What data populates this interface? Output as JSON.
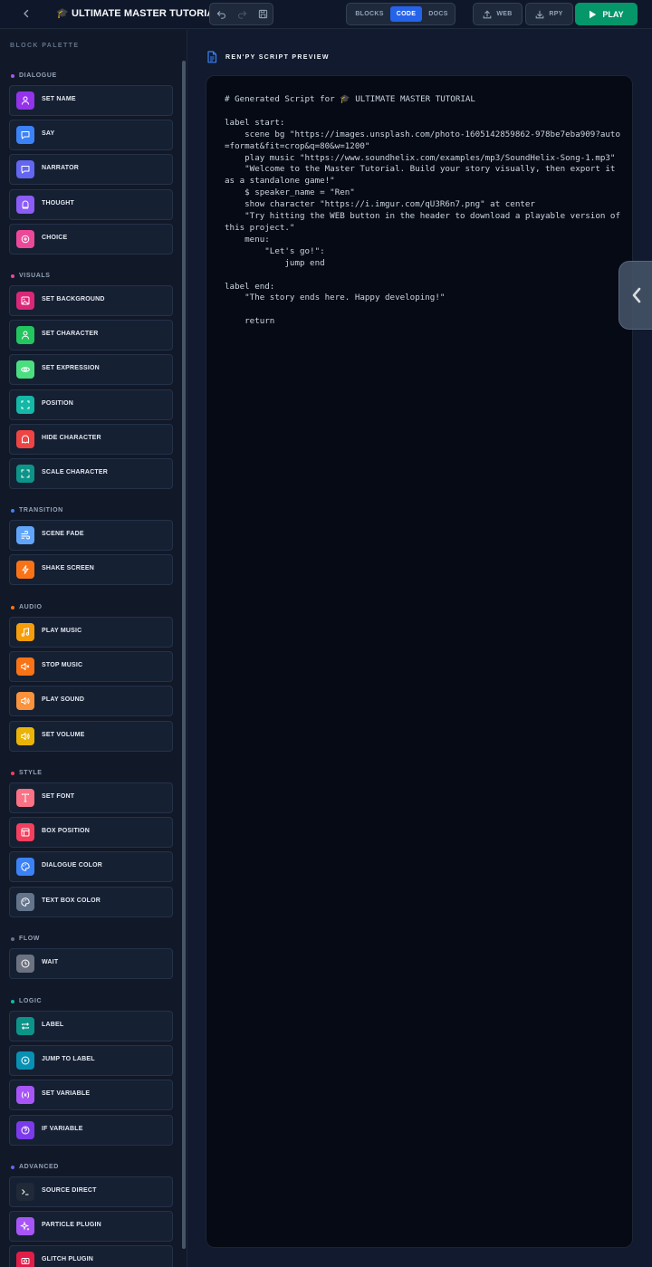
{
  "header": {
    "title": "🎓 ULTIMATE MASTER TUTORIAL",
    "view_tabs": {
      "blocks": "BLOCKS",
      "code": "CODE",
      "docs": "DOCS"
    },
    "export_web": "WEB",
    "export_rpy": "RPY",
    "play": "PLAY"
  },
  "sidebar": {
    "title": "BLOCK PALETTE",
    "categories": [
      {
        "label": "DIALOGUE",
        "color": "#a855f7",
        "items": [
          {
            "label": "SET NAME",
            "icon": "person-icon",
            "color": "#9333ea"
          },
          {
            "label": "SAY",
            "icon": "chat-bubble-icon",
            "color": "#3b82f6"
          },
          {
            "label": "NARRATOR",
            "icon": "chat-bubble-icon",
            "color": "#6366f1"
          },
          {
            "label": "THOUGHT",
            "icon": "thought-bubble-icon",
            "color": "#8b5cf6"
          },
          {
            "label": "CHOICE",
            "icon": "branch-icon",
            "color": "#ec4899"
          }
        ]
      },
      {
        "label": "VISUALS",
        "color": "#ec4899",
        "items": [
          {
            "label": "SET BACKGROUND",
            "icon": "image-icon",
            "color": "#db2777"
          },
          {
            "label": "SET CHARACTER",
            "icon": "person-icon",
            "color": "#22c55e"
          },
          {
            "label": "SET EXPRESSION",
            "icon": "eye-icon",
            "color": "#4ade80"
          },
          {
            "label": "POSITION",
            "icon": "move-icon",
            "color": "#14b8a6"
          },
          {
            "label": "HIDE CHARACTER",
            "icon": "ghost-icon",
            "color": "#ef4444"
          },
          {
            "label": "SCALE CHARACTER",
            "icon": "maximize-icon",
            "color": "#0d9488"
          }
        ]
      },
      {
        "label": "TRANSITION",
        "color": "#3b82f6",
        "items": [
          {
            "label": "SCENE FADE",
            "icon": "wind-icon",
            "color": "#60a5fa"
          },
          {
            "label": "SHAKE SCREEN",
            "icon": "zap-icon",
            "color": "#f97316"
          }
        ]
      },
      {
        "label": "AUDIO",
        "color": "#f97316",
        "items": [
          {
            "label": "PLAY MUSIC",
            "icon": "music-icon",
            "color": "#f59e0b"
          },
          {
            "label": "STOP MUSIC",
            "icon": "mute-icon",
            "color": "#f97316"
          },
          {
            "label": "PLAY SOUND",
            "icon": "speaker-icon",
            "color": "#fb923c"
          },
          {
            "label": "SET VOLUME",
            "icon": "speaker-icon",
            "color": "#eab308"
          }
        ]
      },
      {
        "label": "STYLE",
        "color": "#f43f5e",
        "items": [
          {
            "label": "SET FONT",
            "icon": "type-icon",
            "color": "#fb7185"
          },
          {
            "label": "BOX POSITION",
            "icon": "layout-icon",
            "color": "#f43f5e"
          },
          {
            "label": "DIALOGUE COLOR",
            "icon": "palette-icon",
            "color": "#3b82f6"
          },
          {
            "label": "TEXT BOX COLOR",
            "icon": "palette-icon",
            "color": "#64748b"
          }
        ]
      },
      {
        "label": "FLOW",
        "color": "#64748b",
        "items": [
          {
            "label": "WAIT",
            "icon": "clock-icon",
            "color": "#6b7280"
          }
        ]
      },
      {
        "label": "LOGIC",
        "color": "#14b8a6",
        "items": [
          {
            "label": "LABEL",
            "icon": "repeat-icon",
            "color": "#0d9488"
          },
          {
            "label": "JUMP TO LABEL",
            "icon": "play-circle-icon",
            "color": "#0891b2"
          },
          {
            "label": "SET VARIABLE",
            "icon": "variable-icon",
            "color": "#a855f7"
          },
          {
            "label": "IF VARIABLE",
            "icon": "question-icon",
            "color": "#7c3aed"
          }
        ]
      },
      {
        "label": "ADVANCED",
        "color": "#6366f1",
        "items": [
          {
            "label": "SOURCE DIRECT",
            "icon": "terminal-icon",
            "color": "#1f2937"
          },
          {
            "label": "PARTICLE PLUGIN",
            "icon": "sparkles-icon",
            "color": "#a855f7"
          },
          {
            "label": "GLITCH PLUGIN",
            "icon": "camera-icon",
            "color": "#e11d48"
          }
        ]
      }
    ]
  },
  "main": {
    "preview_title": "REN'PY SCRIPT PREVIEW",
    "code": "# Generated Script for 🎓 ULTIMATE MASTER TUTORIAL\n\nlabel start:\n    scene bg \"https://images.unsplash.com/photo-1605142859862-978be7eba909?auto=format&fit=crop&q=80&w=1200\"\n    play music \"https://www.soundhelix.com/examples/mp3/SoundHelix-Song-1.mp3\"\n    \"Welcome to the Master Tutorial. Build your story visually, then export it as a standalone game!\"\n    $ speaker_name = \"Ren\"\n    show character \"https://i.imgur.com/qU3R6n7.png\" at center\n    \"Try hitting the WEB button in the header to download a playable version of this project.\"\n    menu:\n        \"Let's go!\":\n            jump end\n\nlabel end:\n    \"The story ends here. Happy developing!\"\n\n    return"
  }
}
